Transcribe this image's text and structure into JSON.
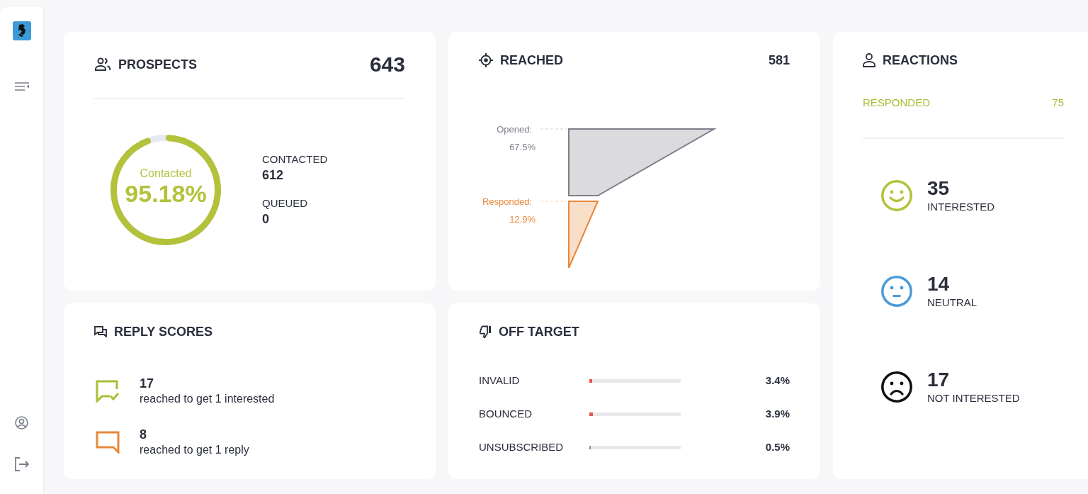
{
  "prospects": {
    "title": "PROSPECTS",
    "total": "643",
    "gauge": {
      "label": "Contacted",
      "value": "95.18%",
      "level": 0.9518
    },
    "stats": [
      {
        "label": "CONTACTED",
        "value": "612"
      },
      {
        "label": "QUEUED",
        "value": "0"
      }
    ]
  },
  "reached": {
    "title": "REACHED",
    "total": "581",
    "funnel": [
      {
        "label": "Opened:",
        "value": "67.5%",
        "color": "#7d808a"
      },
      {
        "label": "Responded:",
        "value": "12.9%",
        "color": "#e8883a"
      }
    ]
  },
  "reactions": {
    "title": "REACTIONS",
    "summary": {
      "label": "RESPONDED",
      "value": "75"
    },
    "items": [
      {
        "kind": "happy",
        "count": "35",
        "label": "INTERESTED",
        "color": "#b3c23a"
      },
      {
        "kind": "neutral",
        "count": "14",
        "label": "NEUTRAL",
        "color": "#4a9ad8"
      },
      {
        "kind": "sad",
        "count": "17",
        "label": "NOT INTERESTED",
        "color": "#111111"
      }
    ]
  },
  "reply_scores": {
    "title": "REPLY SCORES",
    "items": [
      {
        "kind": "check",
        "value": "17",
        "caption": "reached to get 1 interested",
        "color": "#aabe35"
      },
      {
        "kind": "plain",
        "value": "8",
        "caption": "reached to get 1 reply",
        "color": "#e8883a"
      }
    ]
  },
  "off_target": {
    "title": "OFF TARGET",
    "rows": [
      {
        "label": "INVALID",
        "level": 0.034,
        "value": "3.4%",
        "color": "#e8534a"
      },
      {
        "label": "BOUNCED",
        "level": 0.039,
        "value": "3.9%",
        "color": "#e8534a"
      },
      {
        "label": "UNSUBSCRIBED",
        "level": 0.005,
        "value": "0.5%",
        "color": "#8a8d96"
      }
    ]
  }
}
